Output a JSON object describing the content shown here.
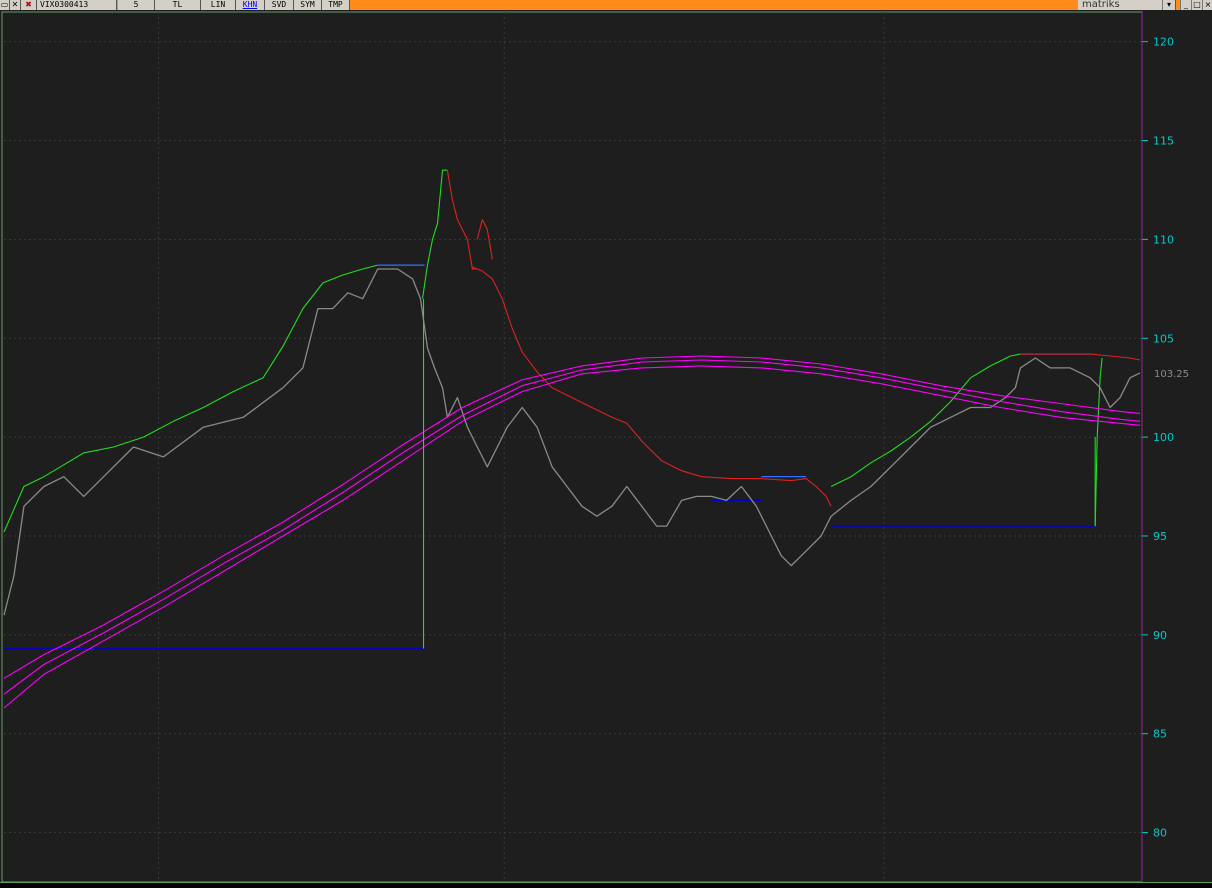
{
  "toolbar": {
    "symbol": "VIX0300413",
    "period": "5",
    "buttons": [
      "TL",
      "LIN",
      "KHN",
      "SVD",
      "SYM",
      "TMP"
    ],
    "active_button": "KHN",
    "brand": "matriks",
    "window_buttons": [
      "_",
      "□",
      "×"
    ]
  },
  "colors": {
    "background": "#1e1e1e",
    "grid": "#3a3a3a",
    "axis_text": "#00c8c8",
    "price": "#8a8a8a",
    "up_trend": "#22dd22",
    "down_trend": "#dd2222",
    "band": "#ff00ff",
    "support": "#0000cc",
    "level": "#3070ff",
    "toolbar_bg": "#ff8c1a"
  },
  "chart_data": {
    "type": "line",
    "y_axis_ticks": [
      "120",
      "115",
      "110",
      "105",
      "100",
      "95",
      "90",
      "85",
      "80"
    ],
    "y_axis_values": [
      120,
      115,
      110,
      105,
      100,
      95,
      90,
      85,
      80
    ],
    "ylim": [
      77.5,
      121.5
    ],
    "last_price_label": "103.25",
    "last_price": 103.25,
    "xlim": [
      0,
      1140
    ],
    "series": [
      {
        "key": "price",
        "values_x": [
          0,
          10,
          20,
          40,
          60,
          80,
          100,
          130,
          160,
          200,
          240,
          280,
          300,
          315,
          330,
          345,
          360,
          375,
          395,
          410,
          418,
          425,
          432,
          440,
          445,
          455,
          465,
          475,
          485,
          495,
          505,
          520,
          535,
          550,
          565,
          580,
          595,
          610,
          625,
          640,
          655,
          665,
          680,
          695,
          710,
          725,
          740,
          755,
          770,
          780,
          790,
          800,
          810,
          820,
          830,
          850,
          870,
          890,
          910,
          930,
          950,
          970,
          990,
          1005,
          1015,
          1020,
          1035,
          1050,
          1070,
          1090,
          1100,
          1110,
          1120,
          1130,
          1140
        ],
        "values_y": [
          91,
          93,
          96.5,
          97.5,
          98,
          97,
          98,
          99.5,
          99,
          100.5,
          101,
          102.5,
          103.5,
          106.5,
          106.5,
          107.3,
          107,
          108.5,
          108.5,
          108,
          107,
          104.5,
          103.5,
          102.5,
          101,
          102,
          100.5,
          99.5,
          98.5,
          99.5,
          100.5,
          101.5,
          100.5,
          98.5,
          97.5,
          96.5,
          96,
          96.5,
          97.5,
          96.5,
          95.5,
          95.5,
          96.8,
          97,
          97,
          96.8,
          97.5,
          96.5,
          95,
          94,
          93.5,
          94,
          94.5,
          95,
          96,
          96.8,
          97.5,
          98.5,
          99.5,
          100.5,
          101,
          101.5,
          101.5,
          102,
          102.5,
          103.5,
          104,
          103.5,
          103.5,
          103,
          102.5,
          101.5,
          102,
          103,
          103.25
        ]
      },
      {
        "key": "trend_up_1",
        "values_x": [
          0,
          20,
          40,
          60,
          80,
          110,
          140,
          170,
          200,
          230,
          260,
          280,
          300,
          320,
          340,
          360,
          375
        ],
        "values_y": [
          95.2,
          97.5,
          98,
          98.6,
          99.2,
          99.5,
          100,
          100.8,
          101.5,
          102.3,
          103,
          104.6,
          106.5,
          107.8,
          108.2,
          108.5,
          108.7
        ]
      },
      {
        "key": "trend_up_2",
        "values_x": [
          420,
          425,
          430,
          435,
          440,
          445
        ],
        "values_y": [
          107,
          108.7,
          110,
          110.8,
          113.5,
          113.5
        ]
      },
      {
        "key": "trend_down_1",
        "values_x": [
          445,
          450,
          455,
          460,
          465,
          470,
          475
        ],
        "values_y": [
          113.5,
          112,
          111,
          110.5,
          110,
          108.5,
          108.5
        ]
      },
      {
        "key": "trend_down_2",
        "values_x": [
          470,
          480,
          490,
          500,
          510,
          520,
          535,
          550
        ],
        "values_y": [
          108.6,
          108.4,
          108,
          107,
          105.5,
          104.3,
          103.3,
          102.5
        ]
      },
      {
        "key": "trend_down_3",
        "values_x": [
          475,
          480,
          485,
          490
        ],
        "values_y": [
          110,
          111,
          110.5,
          109
        ]
      },
      {
        "key": "trend_down_4",
        "values_x": [
          550,
          570,
          590,
          610,
          625,
          640,
          660,
          680,
          700,
          730,
          760,
          790,
          805,
          815,
          825,
          830
        ],
        "values_y": [
          102.5,
          102,
          101.5,
          101,
          100.7,
          99.8,
          98.8,
          98.3,
          98,
          97.9,
          97.9,
          97.8,
          97.9,
          97.5,
          97,
          96.5
        ]
      },
      {
        "key": "trend_up_3",
        "values_x": [
          830,
          850,
          870,
          890,
          910,
          930,
          950,
          970,
          990,
          1010,
          1020
        ],
        "values_y": [
          97.5,
          98,
          98.7,
          99.3,
          100,
          100.8,
          101.8,
          103,
          103.6,
          104.1,
          104.2
        ]
      },
      {
        "key": "trend_up_4",
        "values_x": [
          1095,
          1097,
          1100,
          1102
        ],
        "values_y": [
          95.5,
          100,
          103,
          104
        ]
      },
      {
        "key": "trend_down_5",
        "values_x": [
          1020,
          1060,
          1090,
          1110,
          1130,
          1140
        ],
        "values_y": [
          104.2,
          104.2,
          104.2,
          104.1,
          104,
          103.9
        ]
      },
      {
        "key": "band_upper",
        "values_x": [
          0,
          40,
          100,
          160,
          220,
          280,
          340,
          400,
          460,
          520,
          580,
          640,
          700,
          760,
          820,
          880,
          940,
          1000,
          1060,
          1120,
          1140
        ],
        "values_y": [
          87.8,
          89,
          90.5,
          92.2,
          94,
          95.7,
          97.6,
          99.6,
          101.5,
          102.9,
          103.6,
          104,
          104.1,
          104,
          103.7,
          103.2,
          102.6,
          102.1,
          101.7,
          101.3,
          101.2
        ]
      },
      {
        "key": "band_mid",
        "values_x": [
          0,
          40,
          100,
          160,
          220,
          280,
          340,
          400,
          460,
          520,
          580,
          640,
          700,
          760,
          820,
          880,
          940,
          1000,
          1060,
          1120,
          1140
        ],
        "values_y": [
          87,
          88.5,
          90.1,
          91.8,
          93.6,
          95.3,
          97.2,
          99.2,
          101.1,
          102.6,
          103.4,
          103.8,
          103.9,
          103.8,
          103.5,
          103,
          102.4,
          101.8,
          101.3,
          100.9,
          100.8
        ]
      },
      {
        "key": "band_lower",
        "values_x": [
          0,
          40,
          100,
          160,
          220,
          280,
          340,
          400,
          460,
          520,
          580,
          640,
          700,
          760,
          820,
          880,
          940,
          1000,
          1060,
          1120,
          1140
        ],
        "values_y": [
          86.3,
          88,
          89.7,
          91.4,
          93.2,
          95,
          96.8,
          98.8,
          100.8,
          102.3,
          103.2,
          103.5,
          103.6,
          103.5,
          103.2,
          102.7,
          102.1,
          101.5,
          101,
          100.7,
          100.6
        ]
      }
    ],
    "hlines": [
      {
        "key": "support_1",
        "y": 89.3,
        "x_start": 0,
        "x_end": 422,
        "color_key": "support"
      },
      {
        "key": "level_1",
        "y": 108.7,
        "x_start": 375,
        "x_end": 422,
        "color_key": "level"
      },
      {
        "key": "level_2",
        "y": 98,
        "x_start": 760,
        "x_end": 805,
        "color_key": "level"
      },
      {
        "key": "support_2",
        "y": 95.5,
        "x_start": 830,
        "x_end": 1095,
        "color_key": "support"
      },
      {
        "key": "level_3",
        "y": 104.2,
        "x_start": 1020,
        "x_end": 1090,
        "color_key": "level"
      },
      {
        "key": "support_3",
        "y": 96.8,
        "x_start": 710,
        "x_end": 760,
        "color_key": "support"
      }
    ],
    "vlines": [
      {
        "key": "jump_1",
        "x": 421,
        "y_start": 89.3,
        "y_end": 107,
        "color_key": "up_trend"
      },
      {
        "key": "jump_2",
        "x": 1095,
        "y_start": 95.5,
        "y_end": 100,
        "color_key": "up_trend"
      }
    ],
    "x_grid": [
      155,
      502,
      883
    ],
    "grid": true
  }
}
